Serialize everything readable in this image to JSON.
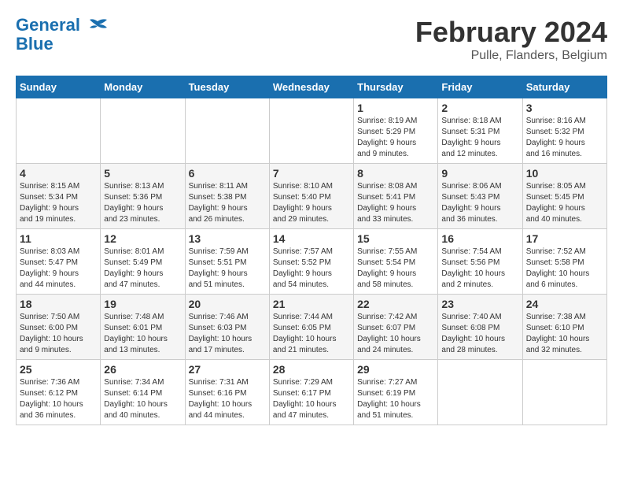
{
  "header": {
    "logo_line1": "General",
    "logo_line2": "Blue",
    "main_title": "February 2024",
    "subtitle": "Pulle, Flanders, Belgium"
  },
  "days_of_week": [
    "Sunday",
    "Monday",
    "Tuesday",
    "Wednesday",
    "Thursday",
    "Friday",
    "Saturday"
  ],
  "weeks": [
    [
      {
        "day": "",
        "info": ""
      },
      {
        "day": "",
        "info": ""
      },
      {
        "day": "",
        "info": ""
      },
      {
        "day": "",
        "info": ""
      },
      {
        "day": "1",
        "info": "Sunrise: 8:19 AM\nSunset: 5:29 PM\nDaylight: 9 hours\nand 9 minutes."
      },
      {
        "day": "2",
        "info": "Sunrise: 8:18 AM\nSunset: 5:31 PM\nDaylight: 9 hours\nand 12 minutes."
      },
      {
        "day": "3",
        "info": "Sunrise: 8:16 AM\nSunset: 5:32 PM\nDaylight: 9 hours\nand 16 minutes."
      }
    ],
    [
      {
        "day": "4",
        "info": "Sunrise: 8:15 AM\nSunset: 5:34 PM\nDaylight: 9 hours\nand 19 minutes."
      },
      {
        "day": "5",
        "info": "Sunrise: 8:13 AM\nSunset: 5:36 PM\nDaylight: 9 hours\nand 23 minutes."
      },
      {
        "day": "6",
        "info": "Sunrise: 8:11 AM\nSunset: 5:38 PM\nDaylight: 9 hours\nand 26 minutes."
      },
      {
        "day": "7",
        "info": "Sunrise: 8:10 AM\nSunset: 5:40 PM\nDaylight: 9 hours\nand 29 minutes."
      },
      {
        "day": "8",
        "info": "Sunrise: 8:08 AM\nSunset: 5:41 PM\nDaylight: 9 hours\nand 33 minutes."
      },
      {
        "day": "9",
        "info": "Sunrise: 8:06 AM\nSunset: 5:43 PM\nDaylight: 9 hours\nand 36 minutes."
      },
      {
        "day": "10",
        "info": "Sunrise: 8:05 AM\nSunset: 5:45 PM\nDaylight: 9 hours\nand 40 minutes."
      }
    ],
    [
      {
        "day": "11",
        "info": "Sunrise: 8:03 AM\nSunset: 5:47 PM\nDaylight: 9 hours\nand 44 minutes."
      },
      {
        "day": "12",
        "info": "Sunrise: 8:01 AM\nSunset: 5:49 PM\nDaylight: 9 hours\nand 47 minutes."
      },
      {
        "day": "13",
        "info": "Sunrise: 7:59 AM\nSunset: 5:51 PM\nDaylight: 9 hours\nand 51 minutes."
      },
      {
        "day": "14",
        "info": "Sunrise: 7:57 AM\nSunset: 5:52 PM\nDaylight: 9 hours\nand 54 minutes."
      },
      {
        "day": "15",
        "info": "Sunrise: 7:55 AM\nSunset: 5:54 PM\nDaylight: 9 hours\nand 58 minutes."
      },
      {
        "day": "16",
        "info": "Sunrise: 7:54 AM\nSunset: 5:56 PM\nDaylight: 10 hours\nand 2 minutes."
      },
      {
        "day": "17",
        "info": "Sunrise: 7:52 AM\nSunset: 5:58 PM\nDaylight: 10 hours\nand 6 minutes."
      }
    ],
    [
      {
        "day": "18",
        "info": "Sunrise: 7:50 AM\nSunset: 6:00 PM\nDaylight: 10 hours\nand 9 minutes."
      },
      {
        "day": "19",
        "info": "Sunrise: 7:48 AM\nSunset: 6:01 PM\nDaylight: 10 hours\nand 13 minutes."
      },
      {
        "day": "20",
        "info": "Sunrise: 7:46 AM\nSunset: 6:03 PM\nDaylight: 10 hours\nand 17 minutes."
      },
      {
        "day": "21",
        "info": "Sunrise: 7:44 AM\nSunset: 6:05 PM\nDaylight: 10 hours\nand 21 minutes."
      },
      {
        "day": "22",
        "info": "Sunrise: 7:42 AM\nSunset: 6:07 PM\nDaylight: 10 hours\nand 24 minutes."
      },
      {
        "day": "23",
        "info": "Sunrise: 7:40 AM\nSunset: 6:08 PM\nDaylight: 10 hours\nand 28 minutes."
      },
      {
        "day": "24",
        "info": "Sunrise: 7:38 AM\nSunset: 6:10 PM\nDaylight: 10 hours\nand 32 minutes."
      }
    ],
    [
      {
        "day": "25",
        "info": "Sunrise: 7:36 AM\nSunset: 6:12 PM\nDaylight: 10 hours\nand 36 minutes."
      },
      {
        "day": "26",
        "info": "Sunrise: 7:34 AM\nSunset: 6:14 PM\nDaylight: 10 hours\nand 40 minutes."
      },
      {
        "day": "27",
        "info": "Sunrise: 7:31 AM\nSunset: 6:16 PM\nDaylight: 10 hours\nand 44 minutes."
      },
      {
        "day": "28",
        "info": "Sunrise: 7:29 AM\nSunset: 6:17 PM\nDaylight: 10 hours\nand 47 minutes."
      },
      {
        "day": "29",
        "info": "Sunrise: 7:27 AM\nSunset: 6:19 PM\nDaylight: 10 hours\nand 51 minutes."
      },
      {
        "day": "",
        "info": ""
      },
      {
        "day": "",
        "info": ""
      }
    ]
  ]
}
